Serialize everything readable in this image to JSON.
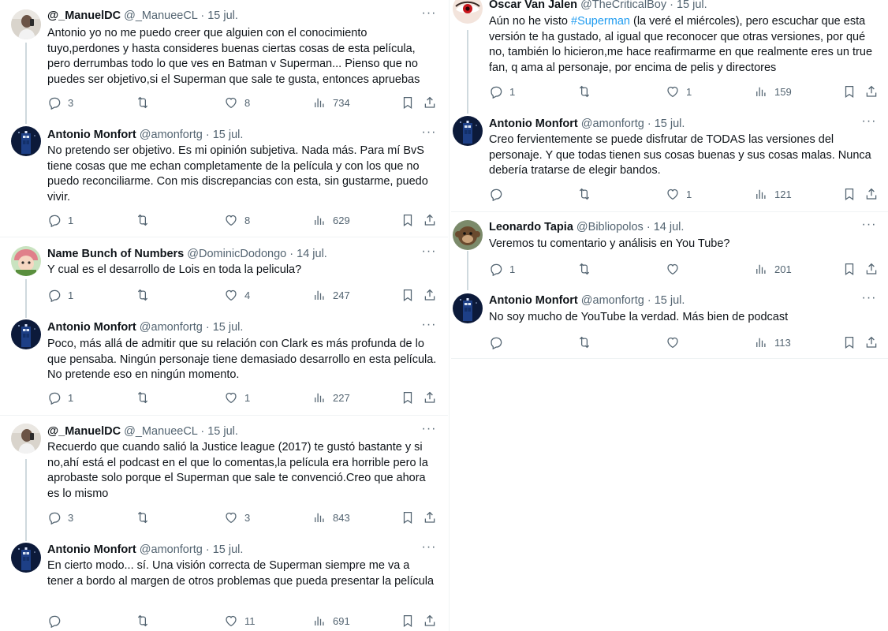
{
  "left": [
    {
      "name": "@_ManuelDC",
      "handle": "@_ManueeCL",
      "date": "15 jul.",
      "avatar": "person-photo",
      "text": "Antonio yo no me puedo creer que alguien con el conocimiento tuyo,perdones y hasta consideres buenas ciertas cosas de esta película, pero derrumbas todo lo que ves en Batman v Superman... Pienso que no puedes ser objetivo,si el Superman que sale te gusta, entonces apruebas",
      "replies": "3",
      "retweets": "",
      "likes": "8",
      "views": "734"
    },
    {
      "name": "Antonio Monfort",
      "handle": "@amonfortg",
      "date": "15 jul.",
      "avatar": "tardis",
      "text": "No pretendo ser objetivo. Es mi opinión subjetiva. Nada más. Para mí BvS tiene cosas que me echan completamente de la película y con los que no puedo reconciliarme. Con mis discrepancias con esta, sin gustarme, puedo vivir.",
      "replies": "1",
      "retweets": "",
      "likes": "8",
      "views": "629"
    },
    {
      "name": "Name Bunch of Numbers",
      "handle": "@DominicDodongo",
      "date": "14 jul.",
      "avatar": "cartoon-character",
      "text": "Y cual es el desarrollo de Lois en toda la pelicula?",
      "replies": "1",
      "retweets": "",
      "likes": "4",
      "views": "247"
    },
    {
      "name": "Antonio Monfort",
      "handle": "@amonfortg",
      "date": "15 jul.",
      "avatar": "tardis",
      "text": "Poco, más allá de admitir que su relación con Clark es más profunda de lo que pensaba. Ningún personaje tiene demasiado desarrollo en esta película. No pretende eso en ningún momento.",
      "replies": "1",
      "retweets": "",
      "likes": "1",
      "views": "227"
    },
    {
      "name": "@_ManuelDC",
      "handle": "@_ManueeCL",
      "date": "15 jul.",
      "avatar": "person-photo",
      "text": "Recuerdo que cuando salió la Justice league (2017) te gustó bastante y si no,ahí está el podcast en el que lo comentas,la película era horrible pero la aprobaste solo porque el Superman que sale te convenció.Creo que ahora es lo mismo",
      "replies": "3",
      "retweets": "",
      "likes": "3",
      "views": "843"
    },
    {
      "name": "Antonio Monfort",
      "handle": "@amonfortg",
      "date": "15 jul.",
      "avatar": "tardis",
      "text": "En cierto modo... sí. Una visión correcta de Superman siempre me va a tener a bordo al margen de otros problemas que pueda presentar la película",
      "replies": "",
      "retweets": "",
      "likes": "11",
      "views": "691"
    }
  ],
  "right": [
    {
      "name": "Oscar Van Jalen",
      "handle": "@TheCriticalBoy",
      "date": "15 jul.",
      "avatar": "eye-closeup",
      "text_before": "Aún no he visto ",
      "hashtag": "#Superman",
      "text_after": " (la veré el miércoles), pero escuchar que esta versión te ha gustado, al igual que reconocer que otras versiones, por qué no, también lo hicieron,me hace reafirmarme en que realmente eres un true fan, q ama al personaje, por encima de pelis y directores",
      "replies": "1",
      "retweets": "",
      "likes": "1",
      "views": "159"
    },
    {
      "name": "Antonio Monfort",
      "handle": "@amonfortg",
      "date": "15 jul.",
      "avatar": "tardis",
      "text": "Creo fervientemente  se puede disfrutar de TODAS las versiones del personaje. Y que todas tienen sus cosas buenas y sus cosas malas. Nunca debería tratarse de elegir bandos.",
      "replies": "",
      "retweets": "",
      "likes": "1",
      "views": "121"
    },
    {
      "name": "Leonardo Tapia",
      "handle": "@Bibliopolos",
      "date": "14 jul.",
      "avatar": "monkey",
      "text": "Veremos tu comentario y análisis en You Tube?",
      "replies": "1",
      "retweets": "",
      "likes": "",
      "views": "201"
    },
    {
      "name": "Antonio Monfort",
      "handle": "@amonfortg",
      "date": "15 jul.",
      "avatar": "tardis",
      "text": "No soy mucho de YouTube la verdad. Más bien de podcast",
      "replies": "",
      "retweets": "",
      "likes": "",
      "views": "113"
    }
  ],
  "ui": {
    "dot": "·",
    "more": "···"
  },
  "colors": {
    "text": "#0f1419",
    "secondary": "#536471",
    "link": "#1d9bf0",
    "border": "#eff3f4",
    "thread": "#cfd9de"
  }
}
